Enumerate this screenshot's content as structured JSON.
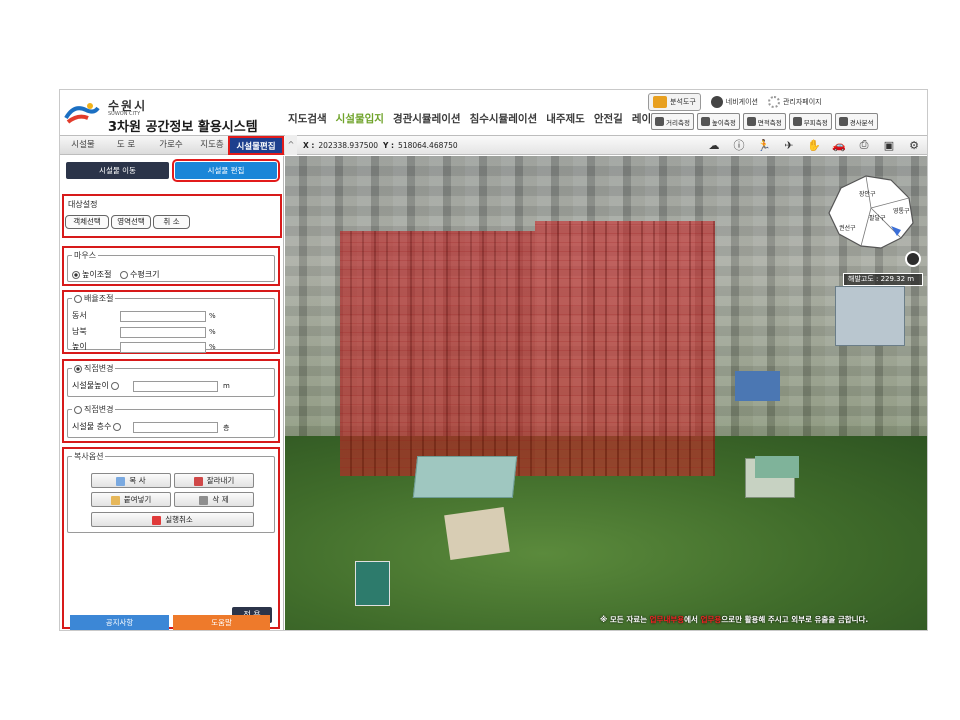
{
  "header": {
    "city": "수원시",
    "city_en": "SUWON CITY",
    "system_title": "3차원 공간정보 활용시스템",
    "main_menu": [
      {
        "label": "지도검색",
        "active": false
      },
      {
        "label": "시설물입지",
        "active": true
      },
      {
        "label": "경관시뮬레이션",
        "active": false
      },
      {
        "label": "침수시뮬레이션",
        "active": false
      },
      {
        "label": "내주제도",
        "active": false
      },
      {
        "label": "안전길",
        "active": false
      },
      {
        "label": "레이어",
        "active": false
      }
    ],
    "utility": {
      "analysis_tool": "분석도구",
      "navigation": "네비게이션",
      "admin_page": "관리자페이지"
    },
    "measure_tools": [
      "거리측정",
      "높이측정",
      "면적측정",
      "부피측정",
      "경사분석"
    ]
  },
  "tabs": [
    {
      "label": "시설물",
      "active": false
    },
    {
      "label": "도 로",
      "active": false
    },
    {
      "label": "가로수",
      "active": false
    },
    {
      "label": "지도층",
      "active": false
    },
    {
      "label": "시설물편집",
      "active": true
    }
  ],
  "coords": {
    "x_label": "X :",
    "x_value": "202338.937500",
    "y_label": "Y :",
    "y_value": "518064.468750"
  },
  "panel": {
    "move_btn": "시설물 이동",
    "edit_btn": "시설물 편집",
    "markers": [
      "①",
      "②",
      "③",
      "④",
      "⑤"
    ],
    "target": {
      "title": "대상설정",
      "buttons": [
        "객체선택",
        "영역선택",
        "취 소"
      ]
    },
    "mouse": {
      "legend": "마우스",
      "options": [
        {
          "label": "높이조절",
          "checked": true
        },
        {
          "label": "수평크기",
          "checked": false
        }
      ]
    },
    "scale": {
      "legend": "배율조절",
      "rows": [
        {
          "label": "동서",
          "value": "",
          "unit": "%"
        },
        {
          "label": "남북",
          "value": "",
          "unit": "%"
        },
        {
          "label": "높이",
          "value": "",
          "unit": "%"
        }
      ]
    },
    "direct_height": {
      "legend": "직접변경",
      "label": "시설물높이",
      "value": "",
      "unit": "m"
    },
    "direct_floors": {
      "legend": "직접변경",
      "label": "시설물 층수",
      "value": "",
      "unit": "층"
    },
    "copy": {
      "legend": "복사옵션",
      "buttons": [
        "복 사",
        "잘라내기",
        "붙여넣기",
        "삭 제"
      ],
      "undo": "실행취소"
    },
    "apply_btn": "적 용",
    "notice_btn": "공지사항",
    "help_btn": "도움말"
  },
  "map": {
    "districts": [
      "장안구",
      "팔달구",
      "영통구",
      "권선구"
    ],
    "altitude": "해발고도 : 229.32 m",
    "disclaimer_pre": "※ 모든 자료는",
    "disclaimer_red1": "업무내부용",
    "disclaimer_mid": "에서",
    "disclaimer_red2": "업무용",
    "disclaimer_post": "으로만 활용해 주시고 외부로 유출을 금합니다."
  },
  "colors": {
    "accent_green": "#6fa32a",
    "active_tab": "#1e3f8e",
    "highlight_red": "#d71a1a",
    "edit_blue": "#1a86d8"
  }
}
